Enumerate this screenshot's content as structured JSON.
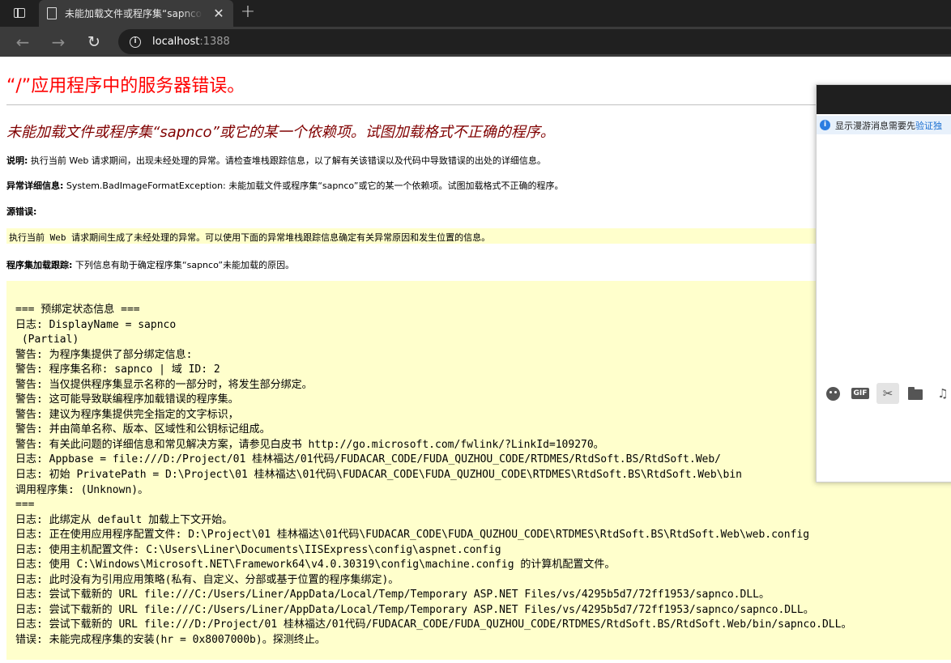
{
  "browser": {
    "tab_title": "未能加载文件或程序集“sapnco”或它的某一个依赖项。",
    "close_glyph": "✕",
    "new_tab_glyph": "+",
    "back_glyph": "←",
    "forward_glyph": "→",
    "refresh_glyph": "↻",
    "url_host": "localhost",
    "url_port": ":1388"
  },
  "page": {
    "title": "“/”应用程序中的服务器错误。",
    "subtitle": "未能加载文件或程序集“sapnco”或它的某一个依赖项。试图加载格式不正确的程序。",
    "description_label": "说明:",
    "description_text": " 执行当前 Web 请求期间，出现未经处理的异常。请检查堆栈跟踪信息，以了解有关该错误以及代码中导致错误的出处的详细信息。",
    "exception_label": "异常详细信息:",
    "exception_text": " System.BadImageFormatException: 未能加载文件或程序集“sapnco”或它的某一个依赖项。试图加载格式不正确的程序。",
    "source_error_label": "源错误:",
    "source_error_box": "执行当前 Web 请求期间生成了未经处理的异常。可以使用下面的异常堆栈跟踪信息确定有关异常原因和发生位置的信息。",
    "assembly_trace_label": "程序集加载跟踪:",
    "assembly_trace_text": " 下列信息有助于确定程序集“sapnco”未能加载的原因。",
    "trace_lines": [
      "=== 预绑定状态信息 ===",
      "日志: DisplayName = sapnco",
      " (Partial)",
      "警告: 为程序集提供了部分绑定信息:",
      "警告: 程序集名称: sapnco | 域 ID: 2",
      "警告: 当仅提供程序集显示名称的一部分时，将发生部分绑定。",
      "警告: 这可能导致联编程序加载错误的程序集。",
      "警告: 建议为程序集提供完全指定的文字标识，",
      "警告: 并由简单名称、版本、区域性和公钥标记组成。",
      "警告: 有关此问题的详细信息和常见解决方案，请参见白皮书 http://go.microsoft.com/fwlink/?LinkId=109270。",
      "日志: Appbase = file:///D:/Project/01 桂林福达/01代码/FUDACAR_CODE/FUDA_QUZHOU_CODE/RTDMES/RtdSoft.BS/RtdSoft.Web/",
      "日志: 初始 PrivatePath = D:\\Project\\01 桂林福达\\01代码\\FUDACAR_CODE\\FUDA_QUZHOU_CODE\\RTDMES\\RtdSoft.BS\\RtdSoft.Web\\bin",
      "调用程序集: (Unknown)。",
      "===",
      "日志: 此绑定从 default 加载上下文开始。",
      "日志: 正在使用应用程序配置文件: D:\\Project\\01 桂林福达\\01代码\\FUDACAR_CODE\\FUDA_QUZHOU_CODE\\RTDMES\\RtdSoft.BS\\RtdSoft.Web\\web.config",
      "日志: 使用主机配置文件: C:\\Users\\Liner\\Documents\\IISExpress\\config\\aspnet.config",
      "日志: 使用 C:\\Windows\\Microsoft.NET\\Framework64\\v4.0.30319\\config\\machine.config 的计算机配置文件。",
      "日志: 此时没有为引用应用策略(私有、自定义、分部或基于位置的程序集绑定)。",
      "日志: 尝试下载新的 URL file:///C:/Users/Liner/AppData/Local/Temp/Temporary ASP.NET Files/vs/4295b5d7/72ff1953/sapnco.DLL。",
      "日志: 尝试下载新的 URL file:///C:/Users/Liner/AppData/Local/Temp/Temporary ASP.NET Files/vs/4295b5d7/72ff1953/sapnco/sapnco.DLL。",
      "日志: 尝试下载新的 URL file:///D:/Project/01 桂林福达/01代码/FUDACAR_CODE/FUDA_QUZHOU_CODE/RTDMES/RtdSoft.BS/RtdSoft.Web/bin/sapnco.DLL。",
      "错误: 未能完成程序集的安装(hr = 0x8007000b)。探测终止。"
    ]
  },
  "chat_panel": {
    "notice_text": "显示漫游消息需要先",
    "notice_link": "验证独",
    "notice_icon": "i",
    "tools": [
      "emoji-icon",
      "gif-icon",
      "scissors-icon",
      "folder-icon",
      "music-icon"
    ],
    "gif_label": "GIF"
  }
}
